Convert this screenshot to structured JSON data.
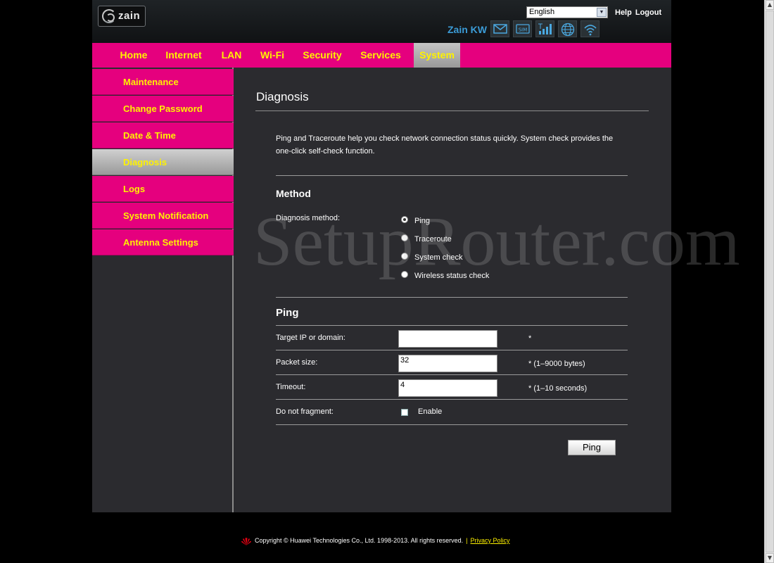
{
  "header": {
    "logo_text": "zain",
    "language": "English",
    "help_label": "Help",
    "logout_label": "Logout",
    "operator": "Zain KW",
    "sim_label": "SIM"
  },
  "nav": {
    "tabs": [
      {
        "label": "Home"
      },
      {
        "label": "Internet"
      },
      {
        "label": "LAN"
      },
      {
        "label": "Wi-Fi"
      },
      {
        "label": "Security"
      },
      {
        "label": "Services"
      },
      {
        "label": "System"
      }
    ],
    "active": "System"
  },
  "sidebar": {
    "items": [
      {
        "label": "Maintenance"
      },
      {
        "label": "Change Password"
      },
      {
        "label": "Date & Time"
      },
      {
        "label": "Diagnosis"
      },
      {
        "label": "Logs"
      },
      {
        "label": "System Notification"
      },
      {
        "label": "Antenna Settings"
      }
    ],
    "active": "Diagnosis"
  },
  "main": {
    "title": "Diagnosis",
    "description": "Ping and Traceroute help you check network connection status quickly. System check provides the one-click self-check function.",
    "method": {
      "heading": "Method",
      "label": "Diagnosis method:",
      "options": [
        "Ping",
        "Traceroute",
        "System check",
        "Wireless status check"
      ],
      "selected": "Ping"
    },
    "ping": {
      "heading": "Ping",
      "target_label": "Target IP or domain:",
      "target_value": "",
      "target_hint": "*",
      "packet_label": "Packet size:",
      "packet_value": "32",
      "packet_hint": "* (1–9000 bytes)",
      "timeout_label": "Timeout:",
      "timeout_value": "4",
      "timeout_hint": "* (1–10 seconds)",
      "fragment_label": "Do not fragment:",
      "fragment_option": "Enable",
      "button_label": "Ping"
    }
  },
  "watermark": "SetupRouter.com",
  "footer": {
    "copyright": "Copyright © Huawei Technologies Co., Ltd. 1998-2013. All rights reserved.",
    "separator": "|",
    "privacy": "Privacy Policy"
  },
  "colors": {
    "accent": "#e5007e",
    "accent_text": "#fff200",
    "background": "#2b2b2f"
  }
}
